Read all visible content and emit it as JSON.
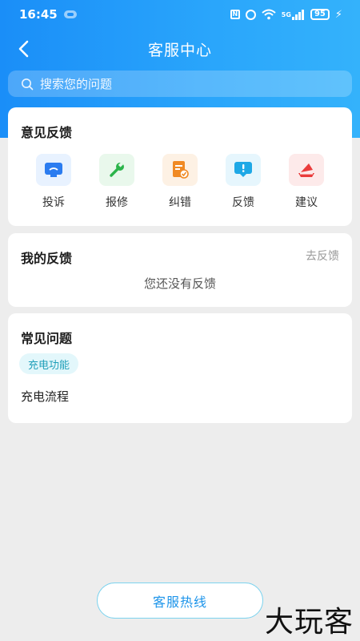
{
  "status_bar": {
    "time": "16:45",
    "network": "5G",
    "battery": "95"
  },
  "header": {
    "title": "客服中心"
  },
  "search": {
    "placeholder": "搜索您的问题"
  },
  "feedback": {
    "title": "意见反馈",
    "items": [
      {
        "label": "投诉",
        "icon": "complaint-icon",
        "color": "#2b7cf0"
      },
      {
        "label": "报修",
        "icon": "wrench-icon",
        "color": "#2bb44a"
      },
      {
        "label": "纠错",
        "icon": "correction-icon",
        "color": "#f08a24"
      },
      {
        "label": "反馈",
        "icon": "feedback-message-icon",
        "color": "#1ea8e6"
      },
      {
        "label": "建议",
        "icon": "suggestion-icon",
        "color": "#ea3c3c"
      }
    ]
  },
  "my_feedback": {
    "title": "我的反馈",
    "action": "去反馈",
    "empty_text": "您还没有反馈"
  },
  "faq": {
    "title": "常见问题",
    "tag": "充电功能",
    "items": [
      "充电流程"
    ]
  },
  "footer": {
    "hotline_label": "客服热线"
  },
  "watermark": "大玩客",
  "colors": {
    "accent": "#1a8ef8",
    "page_bg": "#ededed",
    "hotline_text": "#1c94ea",
    "tag_text": "#1f9fb9"
  }
}
